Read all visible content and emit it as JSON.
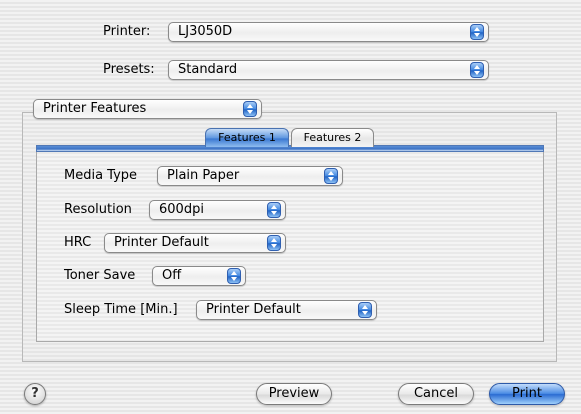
{
  "header": {
    "printer_label": "Printer:",
    "printer_value": "LJ3050D",
    "presets_label": "Presets:",
    "presets_value": "Standard"
  },
  "panel_select": {
    "value": "Printer Features"
  },
  "tabs": [
    {
      "label": "Features 1",
      "active": true
    },
    {
      "label": "Features 2",
      "active": false
    }
  ],
  "features": {
    "media_type_label": "Media Type",
    "media_type_value": "Plain Paper",
    "resolution_label": "Resolution",
    "resolution_value": "600dpi",
    "hrc_label": "HRC",
    "hrc_value": "Printer Default",
    "toner_save_label": "Toner Save",
    "toner_save_value": "Off",
    "sleep_time_label": "Sleep Time [Min.]",
    "sleep_time_value": "Printer Default"
  },
  "footer": {
    "help_label": "?",
    "preview_label": "Preview",
    "cancel_label": "Cancel",
    "print_label": "Print"
  },
  "colors": {
    "accent_blue": "#3b79d2",
    "background": "#ececec"
  },
  "icons": [
    "popup-arrows-icon",
    "help-icon"
  ]
}
